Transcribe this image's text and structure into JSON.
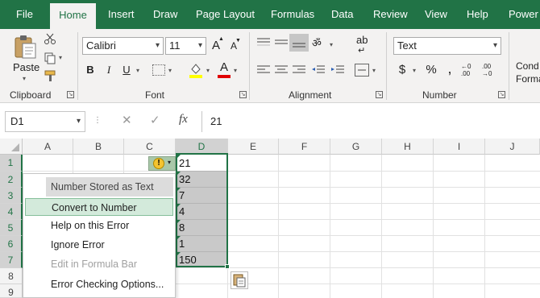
{
  "tabs": [
    {
      "label": "File"
    },
    {
      "label": "Home",
      "active": true
    },
    {
      "label": "Insert"
    },
    {
      "label": "Draw"
    },
    {
      "label": "Page Layout"
    },
    {
      "label": "Formulas"
    },
    {
      "label": "Data"
    },
    {
      "label": "Review"
    },
    {
      "label": "View"
    },
    {
      "label": "Help"
    },
    {
      "label": "Power P"
    }
  ],
  "ribbon": {
    "clipboard": {
      "paste_label": "Paste",
      "group_label": "Clipboard"
    },
    "font": {
      "font_name": "Calibri",
      "font_size": "11",
      "bold": "B",
      "italic": "I",
      "underline": "U",
      "grow": "A",
      "shrink": "A",
      "font_color": "A",
      "group_label": "Font"
    },
    "alignment": {
      "group_label": "Alignment",
      "wrap": "ab"
    },
    "number": {
      "format": "Text",
      "currency": "$",
      "percent": "%",
      "group_label": "Number"
    },
    "styles": {
      "cond_line1": "Cond",
      "cond_line2": "Forma"
    }
  },
  "formula_bar": {
    "name_box": "D1",
    "fx": "fx",
    "value": "21"
  },
  "grid": {
    "columns": [
      "A",
      "B",
      "C",
      "D",
      "E",
      "F",
      "G",
      "H",
      "I",
      "J"
    ],
    "rows": [
      "1",
      "2",
      "3",
      "4",
      "5",
      "6",
      "7",
      "8",
      "9"
    ],
    "selected_column": "D",
    "d_values": [
      "21",
      "32",
      "7",
      "4",
      "8",
      "1",
      "150"
    ]
  },
  "error_menu": {
    "header": "Number Stored as Text",
    "items": [
      {
        "label": "Convert to Number",
        "state": "hover"
      },
      {
        "label": "Help on this Error",
        "state": "normal"
      },
      {
        "label": "Ignore Error",
        "state": "normal"
      },
      {
        "label": "Edit in Formula Bar",
        "state": "disabled"
      },
      {
        "label": "Error Checking Options...",
        "state": "normal"
      }
    ]
  },
  "colors": {
    "accent": "#217346",
    "selection": "#c9c9c9",
    "hover": "#d3eadb"
  }
}
